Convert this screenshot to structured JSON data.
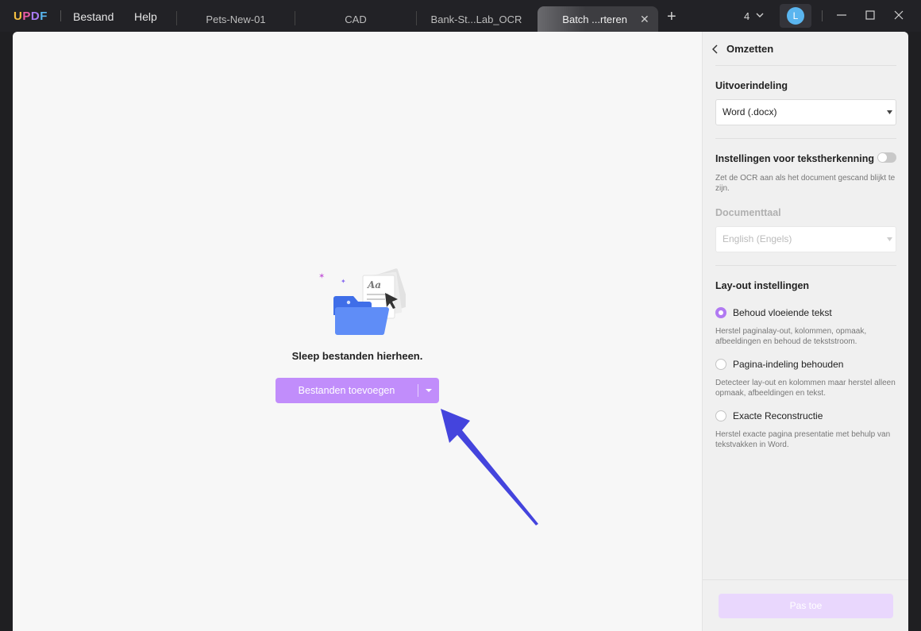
{
  "app": {
    "logo_letters": [
      "U",
      "P",
      "D",
      "F"
    ],
    "logo_colors": [
      "#f6c142",
      "#ec5ba6",
      "#a97bf6",
      "#59b8f2"
    ]
  },
  "menu": {
    "file": "Bestand",
    "help": "Help"
  },
  "tabs": [
    {
      "label": "Pets-New-01",
      "active": false
    },
    {
      "label": "CAD",
      "active": false
    },
    {
      "label": "Bank-St...Lab_OCR",
      "active": false
    },
    {
      "label": "Batch ...rteren",
      "active": true
    }
  ],
  "titlebar": {
    "tab_count": "4",
    "avatar_letter": "L"
  },
  "dropzone": {
    "text": "Sleep bestanden hierheen.",
    "add_button": "Bestanden toevoegen"
  },
  "panel": {
    "title": "Omzetten",
    "output_format_label": "Uitvoerindeling",
    "output_format_value": "Word (.docx)",
    "ocr_label": "Instellingen voor tekstherkenning",
    "ocr_enabled": false,
    "ocr_desc": "Zet de OCR aan als het document gescand blijkt te zijn.",
    "doc_lang_label": "Documenttaal",
    "doc_lang_value": "English (Engels)",
    "layout_label": "Lay-out instellingen",
    "layout_options": [
      {
        "label": "Behoud vloeiende tekst",
        "desc": "Herstel paginalay-out, kolommen, opmaak, afbeeldingen en behoud de tekststroom.",
        "checked": true
      },
      {
        "label": "Pagina-indeling behouden",
        "desc": "Detecteer lay-out en kolommen maar herstel alleen opmaak, afbeeldingen en tekst.",
        "checked": false
      },
      {
        "label": "Exacte Reconstructie",
        "desc": "Herstel exacte pagina presentatie met behulp van tekstvakken in Word.",
        "checked": false
      }
    ],
    "apply_button": "Pas toe"
  },
  "colors": {
    "accent": "#c18dfb",
    "annotation_arrow": "#4444dd"
  }
}
